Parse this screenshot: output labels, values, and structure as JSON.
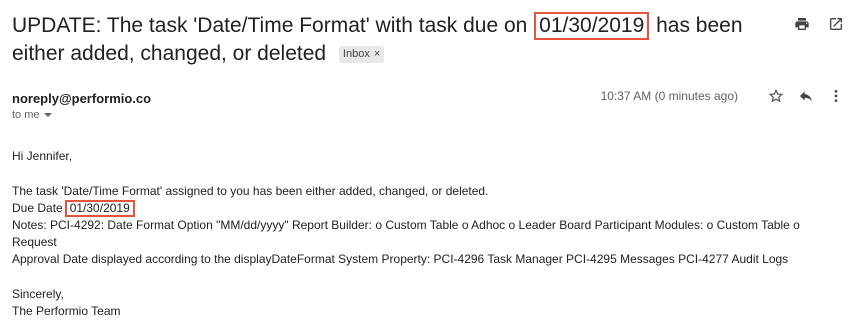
{
  "email": {
    "subject_before": "UPDATE: The task 'Date/Time Format' with task due on",
    "subject_date": "01/30/2019",
    "subject_after": "has been either added, changed, or deleted",
    "label": "Inbox",
    "label_close": "×",
    "sender": "noreply@performio.co",
    "to": "to me",
    "time": "10:37 AM (0 minutes ago)",
    "greeting": "Hi Jennifer,",
    "line1": "The task 'Date/Time Format' assigned to you has been either added, changed, or deleted.",
    "due_label": "Due Date",
    "due_date": "01/30/2019",
    "notes_line1": "Notes: PCI-4292: Date Format Option \"MM/dd/yyyy\" Report Builder: o Custom Table o Adhoc o Leader Board Participant Modules: o Custom Table o Request",
    "notes_line2": "Approval Date displayed according to the displayDateFormat System Property: PCI-4296 Task Manager PCI-4295 Messages PCI-4277 Audit Logs",
    "closing": "Sincerely,",
    "signature": "The Performio Team"
  },
  "icons": {
    "print": "print-icon",
    "open_new_window": "open-in-new-window-icon",
    "star": "star-icon",
    "reply": "reply-icon",
    "more": "more-vertical-icon"
  },
  "colors": {
    "highlight_border": "#e8533e",
    "label_bg": "#e8e8e8",
    "secondary_text": "#5f6368"
  }
}
